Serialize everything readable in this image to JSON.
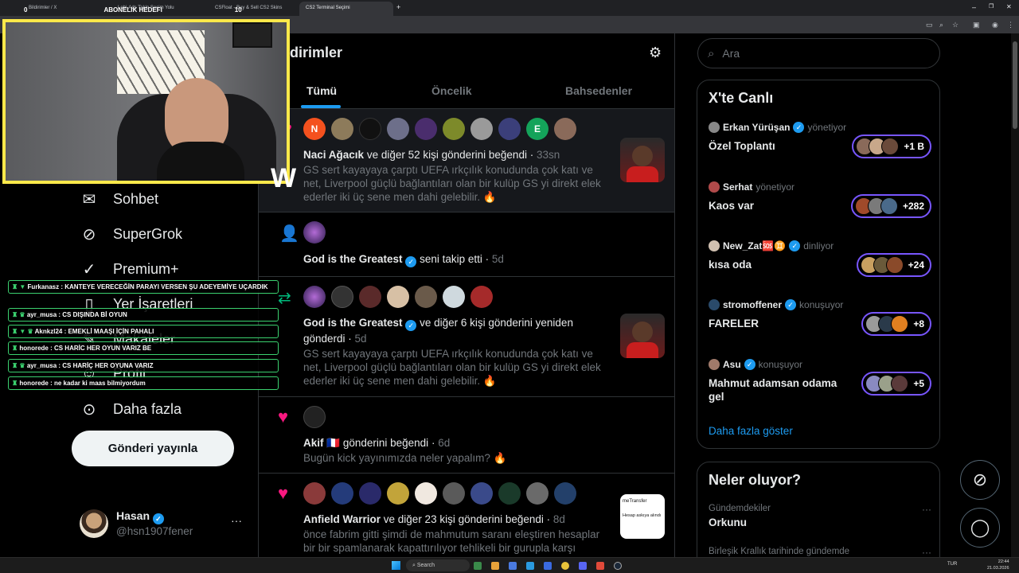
{
  "browser": {
    "tabs": [
      "Bildirimler / X",
      "Lobi-Ads Takip Seçim Yolu",
      "CSFloat - Buy & Sell CS2 Skins",
      "CS2 Terminal Seçimi"
    ],
    "new_tab": "+",
    "window_controls": [
      "–",
      "❐",
      "✕"
    ]
  },
  "overlay": {
    "header_left": "0",
    "header_title": "ABONELIK HEDEFI",
    "header_right": "10"
  },
  "chat": [
    {
      "user": "Furkanasz",
      "msg": "KANTEYE VERECEĞİN PARAYI VERSEN ŞU ADEYEMİYE UÇARDIK"
    },
    {
      "user": "ayr_musa",
      "msg": "CS DIŞINDA Bİ OYUN"
    },
    {
      "user": "Aknkzl24",
      "msg": "EMEKLİ MAAŞI İÇİN PAHALI"
    },
    {
      "user": "honorede",
      "msg": "CS HARİC HER OYUN VARIZ BE"
    },
    {
      "user": "ayr_musa",
      "msg": "CS HARİÇ HER OYUNA VARIZ"
    },
    {
      "user": "honorede",
      "msg": "ne kadar ki maas bilmiyordum"
    }
  ],
  "nav": {
    "items": [
      "Sohbet",
      "SuperGrok",
      "Premium+",
      "Yer İşaretleri",
      "Makaleler",
      "Profil",
      "Daha fazla"
    ],
    "post_button": "Gönderi yayınla",
    "profile_name": "Hasan",
    "profile_handle": "@hsn1907fener",
    "profile_more": "···"
  },
  "center": {
    "title": "Bildirimler",
    "tabs": [
      "Tümü",
      "Öncelik",
      "Bahsedenler"
    ],
    "notifications": [
      {
        "actor": "Naci Ağacık",
        "action": "ve diğer 52 kişi gönderini beğendi",
        "time": "33sn",
        "body": "GS sert kayayaya çarptı UEFA ırkçılık konudunda çok katı ve net, Liverpool güçlü bağlantıları olan bir kulüp GS yi direkt elek ederler iki üç sene men dahi gelebilir. 🔥"
      },
      {
        "actor": "God is the Greatest",
        "action": "seni takip etti",
        "time": "5d"
      },
      {
        "actor": "God is the Greatest",
        "action": "ve diğer 6 kişi gönderini yeniden gönderdi",
        "time": "5d",
        "body": "GS sert kayayaya çarptı UEFA ırkçılık konudunda çok katı ve net, Liverpool güçlü bağlantıları olan bir kulüp GS yi direkt elek ederler iki üç sene men dahi gelebilir. 🔥"
      },
      {
        "actor": "Akif 🇫🇷",
        "action": "gönderini beğendi",
        "time": "6d",
        "body": "Bugün kick yayınımızda neler yapalım? 🔥"
      },
      {
        "actor": "Anfield Warrior",
        "action": "ve diğer 23 kişi gönderini beğendi",
        "time": "8d",
        "body": "önce fabrim gitti şimdi de mahmutum saranı eleştiren hesaplar bir bir spamlanarak kapattırılıyor tehlikeli bir gurupla karşı",
        "thumb_lines": [
          "meTransfer",
          "Hesap askıya alındı"
        ]
      }
    ]
  },
  "right": {
    "search_placeholder": "Ara",
    "live_title": "X'te Canlı",
    "live": [
      {
        "host": "Erkan Yürüşan",
        "status": "yönetiyor",
        "title": "Özel Toplantı",
        "count": "+1 B"
      },
      {
        "host": "Serhat",
        "status": "yönetiyor",
        "title": "Kaos var",
        "count": "+282"
      },
      {
        "host": "New_Zat🆘♊",
        "status": "dinliyor",
        "title": "kısa oda",
        "count": "+24"
      },
      {
        "host": "stromoffener",
        "status": "konuşuyor",
        "title": "FARELER",
        "count": "+8"
      },
      {
        "host": "Asu",
        "status": "konuşuyor",
        "title": "Mahmut adamsan odama gel",
        "count": "+5"
      }
    ],
    "show_more": "Daha fazla göster",
    "trends_title": "Neler oluyor?",
    "trends": [
      {
        "context": "Gündemdekiler",
        "name": "Orkunu"
      },
      {
        "context": "Birleşik Krallık tarihinde gündemde",
        "name": ""
      }
    ]
  },
  "taskbar": {
    "search": "Search",
    "lang": "TUR",
    "time": "22:44",
    "date": "21.03.2026"
  },
  "colors": {
    "accent": "#1d9bf0",
    "like": "#f91880",
    "retweet": "#00ba7c",
    "follow": "#1d9bf0",
    "webcam_border": "#fde94a",
    "chat_border": "#3bd16f",
    "live_pill": "#7856ff"
  }
}
